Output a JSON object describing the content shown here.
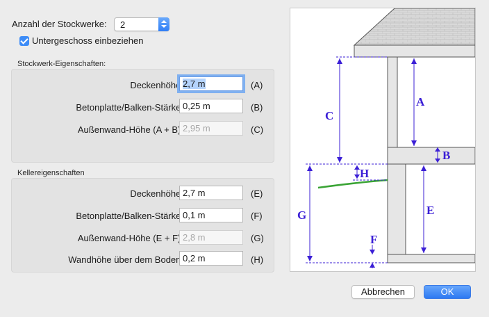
{
  "floors": {
    "label": "Anzahl der Stockwerke:",
    "value": "2"
  },
  "basement_checkbox": {
    "label": "Untergeschoss einbeziehen",
    "checked": true
  },
  "story_section": {
    "title": "Stockwerk-Eigenschaften:",
    "rows": [
      {
        "label": "Deckenhöhe:",
        "value": "2,7 m",
        "ref": "(A)"
      },
      {
        "label": "Betonplatte/Balken-Stärke:",
        "value": "0,25 m",
        "ref": "(B)"
      },
      {
        "label": "Außenwand-Höhe (A + B):",
        "value": "2,95 m",
        "ref": "(C)"
      }
    ]
  },
  "basement_section": {
    "title": "Kellereigenschaften",
    "rows": [
      {
        "label": "Deckenhöhe:",
        "value": "2,7 m",
        "ref": "(E)"
      },
      {
        "label": "Betonplatte/Balken-Stärke:",
        "value": "0,1 m",
        "ref": "(F)"
      },
      {
        "label": "Außenwand-Höhe (E + F):",
        "value": "2,8 m",
        "ref": "(G)"
      },
      {
        "label": "Wandhöhe über dem Boden:",
        "value": "0,2 m",
        "ref": "(H)"
      }
    ]
  },
  "diagram": {
    "labels": {
      "A": "A",
      "B": "B",
      "C": "C",
      "E": "E",
      "F": "F",
      "G": "G",
      "H": "H"
    },
    "colors": {
      "dimension": "#3b1fd6",
      "ground": "#3aa435",
      "wall": "#e6e6e6",
      "outline": "#333333"
    }
  },
  "buttons": {
    "cancel": "Abbrechen",
    "ok": "OK"
  },
  "colors": {
    "accent": "#2d79f2",
    "background": "#ececec"
  }
}
